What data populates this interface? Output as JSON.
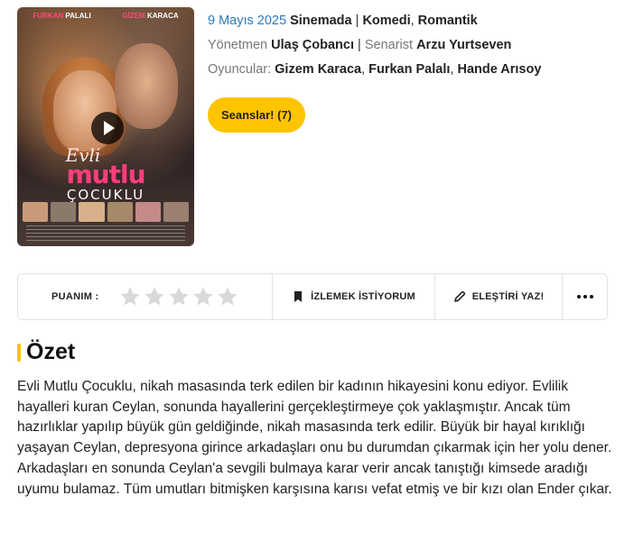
{
  "poster": {
    "actor1_name": "FURKAN",
    "actor1_surname": "PALALI",
    "actor2_name": "GİZEM",
    "actor2_surname": "KARACA",
    "logo_line1": "Evli",
    "logo_line2": "mutlu",
    "logo_line3": "ÇOCUKLU"
  },
  "meta": {
    "release_date": "9 Mayıs 2025",
    "release_place": "Sinemada",
    "genres": [
      "Komedi",
      "Romantik"
    ],
    "director_label": "Yönetmen",
    "director": "Ulaş Çobancı",
    "writer_label": "Senarist",
    "writer": "Arzu Yurtseven",
    "cast_label": "Oyuncular:",
    "cast": [
      "Gizem Karaca",
      "Furkan Palalı",
      "Hande Arısoy"
    ]
  },
  "seans_button": "Seanslar! (7)",
  "action_bar": {
    "rating_label": "PUANIM :",
    "stars_total": 5,
    "stars_selected": 0,
    "watchlist_label": "İZLEMEK İSTİYORUM",
    "critic_label": "ELEŞTİRİ YAZ!"
  },
  "summary": {
    "heading": "Özet",
    "text": "Evli Mutlu Çocuklu, nikah masasında terk edilen bir kadının hikayesini konu ediyor. Evlilik hayalleri kuran Ceylan, sonunda hayallerini gerçekleştirmeye çok yaklaşmıştır. Ancak tüm hazırlıklar yapılıp büyük gün geldiğinde, nikah masasında terk edilir. Büyük bir hayal kırıklığı yaşayan Ceylan, depresyona girince arkadaşları onu bu durumdan çıkarmak için her yolu dener. Arkadaşları en sonunda Ceylan'a sevgili bulmaya karar verir ancak tanıştığı kimsede aradığı uyumu bulamaz. Tüm umutları bitmişken karşısına karısı vefat etmiş ve bir kızı olan Ender çıkar."
  },
  "colors": {
    "accent": "#ffc400",
    "link_blue": "#2a7bbf",
    "star_empty": "#d9d9d9"
  }
}
